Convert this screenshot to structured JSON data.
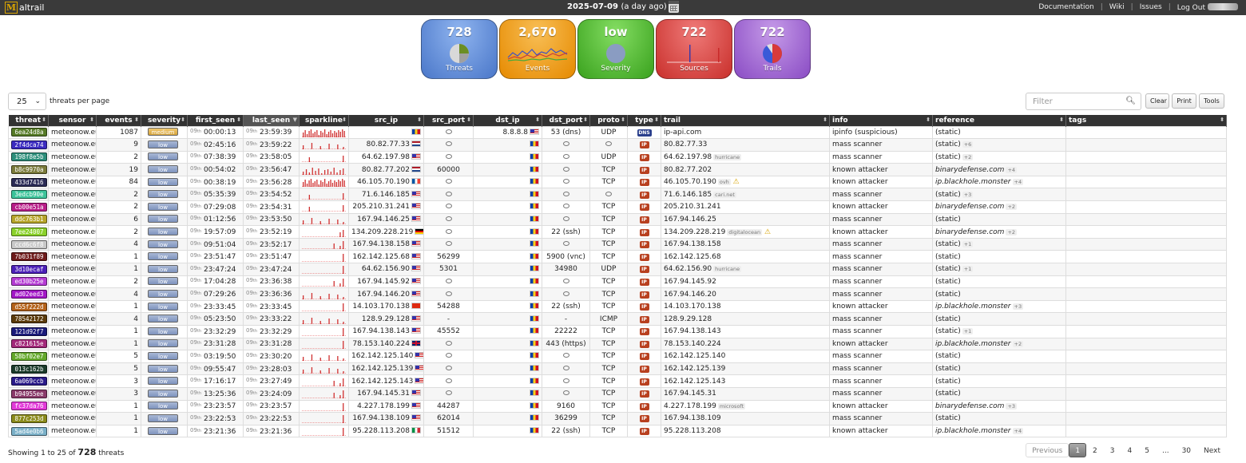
{
  "header": {
    "logo_text": "altrail",
    "date": "2025-07-09",
    "date_rel": "(a day ago)",
    "nav": [
      "Documentation",
      "Wiki",
      "Issues",
      "Log Out"
    ]
  },
  "tiles": [
    {
      "value": "728",
      "label": "Threats"
    },
    {
      "value": "2,670",
      "label": "Events"
    },
    {
      "value": "low",
      "label": "Severity"
    },
    {
      "value": "722",
      "label": "Sources"
    },
    {
      "value": "722",
      "label": "Trails"
    }
  ],
  "controls": {
    "per_page_value": "25",
    "per_page_label": "threats per page",
    "filter_placeholder": "Filter",
    "clear": "Clear",
    "print": "Print",
    "tools": "Tools"
  },
  "columns": [
    "threat",
    "sensor",
    "events",
    "severity",
    "first_seen",
    "last_seen",
    "sparkline",
    "src_ip",
    "src_port",
    "dst_ip",
    "dst_port",
    "proto",
    "type",
    "trail",
    "info",
    "reference",
    "tags"
  ],
  "colors": {
    "low": "#8a9cc2",
    "medium": "#e2b548",
    "ip_badge": "#b8401f",
    "dns_badge": "#2a3f8c"
  },
  "rows": [
    {
      "threat": "6ea24d8a",
      "color": "#557a26",
      "sensor": "meteonow.eu",
      "events": "1087",
      "severity": "medium",
      "first_sup": "th",
      "first_day": "09",
      "first_time": "00:00:13",
      "last_day": "09",
      "last_time": "23:59:39",
      "src_ip": "",
      "src_flag": "ro",
      "src_port": "",
      "dst_ip": "8.8.8.8",
      "dst_flag": "us",
      "dst_port": "53 (dns)",
      "proto": "UDP",
      "type": "DNS",
      "trail": "ip-api.com",
      "trail_tag": "",
      "warn": false,
      "info": "ipinfo (suspicious)",
      "reference": "(static)",
      "ref_extra": "",
      "ital": false,
      "spark": "dense"
    },
    {
      "threat": "2f4dca74",
      "color": "#3b2bc0",
      "sensor": "meteonow.eu",
      "events": "9",
      "severity": "low",
      "first_day": "09",
      "first_time": "02:45:16",
      "last_day": "09",
      "last_time": "23:59:22",
      "src_ip": "80.82.77.33",
      "src_flag": "nl",
      "src_port": "",
      "dst_ip": "",
      "dst_flag": "ro",
      "dst_port": "",
      "proto": "",
      "type": "IP",
      "trail": "80.82.77.33",
      "trail_tag": "",
      "warn": false,
      "info": "mass scanner",
      "reference": "(static)",
      "ref_extra": "+6",
      "ital": false,
      "spark": "few"
    },
    {
      "threat": "198f8e5b",
      "color": "#2c8e7a",
      "sensor": "meteonow.eu",
      "events": "2",
      "severity": "low",
      "first_day": "09",
      "first_time": "07:38:39",
      "last_day": "09",
      "last_time": "23:58:05",
      "src_ip": "64.62.197.98",
      "src_flag": "us",
      "src_port": "",
      "dst_ip": "",
      "dst_flag": "ro",
      "dst_port": "",
      "proto": "UDP",
      "type": "IP",
      "trail": "64.62.197.98",
      "trail_tag": "hurricane",
      "warn": false,
      "info": "mass scanner",
      "reference": "(static)",
      "ref_extra": "+2",
      "ital": false,
      "spark": "two"
    },
    {
      "threat": "b8c9970a",
      "color": "#7a7a3a",
      "sensor": "meteonow.eu",
      "events": "19",
      "severity": "low",
      "first_day": "09",
      "first_time": "00:54:02",
      "last_day": "09",
      "last_time": "23:56:47",
      "src_ip": "80.82.77.202",
      "src_flag": "nl",
      "src_port": "60000",
      "dst_ip": "",
      "dst_flag": "ro",
      "dst_port": "",
      "proto": "TCP",
      "type": "IP",
      "trail": "80.82.77.202",
      "trail_tag": "",
      "warn": false,
      "info": "known attacker",
      "reference": "binarydefense.com",
      "ref_extra": "+4",
      "ital": true,
      "spark": "many"
    },
    {
      "threat": "433d7416",
      "color": "#2a2a55",
      "sensor": "meteonow.eu",
      "events": "84",
      "severity": "low",
      "first_day": "09",
      "first_time": "00:38:19",
      "last_day": "09",
      "last_time": "23:56:28",
      "src_ip": "46.105.70.190",
      "src_flag": "fr",
      "src_port": "",
      "dst_ip": "",
      "dst_flag": "ro",
      "dst_port": "",
      "proto": "TCP",
      "type": "IP",
      "trail": "46.105.70.190",
      "trail_tag": "ovh",
      "warn": true,
      "info": "known attacker",
      "reference": "ip.blackhole.monster",
      "ref_extra": "+4",
      "ital": true,
      "spark": "dense"
    },
    {
      "threat": "3edcb90e",
      "color": "#3cc39a",
      "sensor": "meteonow.eu",
      "events": "2",
      "severity": "low",
      "first_day": "09",
      "first_time": "05:35:39",
      "last_day": "09",
      "last_time": "23:54:52",
      "src_ip": "71.6.146.185",
      "src_flag": "us",
      "src_port": "",
      "dst_ip": "",
      "dst_flag": "ro",
      "dst_port": "",
      "proto": "",
      "type": "IP",
      "trail": "71.6.146.185",
      "trail_tag": "cari.net",
      "warn": false,
      "info": "mass scanner",
      "reference": "(static)",
      "ref_extra": "+3",
      "ital": false,
      "spark": "two"
    },
    {
      "threat": "cb00e51a",
      "color": "#b81d88",
      "sensor": "meteonow.eu",
      "events": "2",
      "severity": "low",
      "first_day": "09",
      "first_time": "07:29:08",
      "last_day": "09",
      "last_time": "23:54:31",
      "src_ip": "205.210.31.241",
      "src_flag": "us",
      "src_port": "",
      "dst_ip": "",
      "dst_flag": "ro",
      "dst_port": "",
      "proto": "TCP",
      "type": "IP",
      "trail": "205.210.31.241",
      "trail_tag": "",
      "warn": false,
      "info": "known attacker",
      "reference": "binarydefense.com",
      "ref_extra": "+2",
      "ital": true,
      "spark": "two"
    },
    {
      "threat": "ddc763b1",
      "color": "#b7a52a",
      "sensor": "meteonow.eu",
      "events": "6",
      "severity": "low",
      "first_day": "09",
      "first_time": "01:12:56",
      "last_day": "09",
      "last_time": "23:53:50",
      "src_ip": "167.94.146.25",
      "src_flag": "us",
      "src_port": "",
      "dst_ip": "",
      "dst_flag": "ro",
      "dst_port": "",
      "proto": "TCP",
      "type": "IP",
      "trail": "167.94.146.25",
      "trail_tag": "",
      "warn": false,
      "info": "mass scanner",
      "reference": "(static)",
      "ref_extra": "",
      "ital": false,
      "spark": "few"
    },
    {
      "threat": "7ee24007",
      "color": "#8ad12a",
      "sensor": "meteonow.eu",
      "events": "2",
      "severity": "low",
      "first_day": "09",
      "first_time": "19:57:09",
      "last_day": "09",
      "last_time": "23:52:19",
      "src_ip": "134.209.228.219",
      "src_flag": "de",
      "src_port": "",
      "dst_ip": "",
      "dst_flag": "ro",
      "dst_port": "22 (ssh)",
      "proto": "TCP",
      "type": "IP",
      "trail": "134.209.228.219",
      "trail_tag": "digitalocean",
      "warn": true,
      "info": "known attacker",
      "reference": "binarydefense.com",
      "ref_extra": "+2",
      "ital": true,
      "spark": "endtwo"
    },
    {
      "threat": "ccd6c6f8",
      "color": "#c9c9c9",
      "sensor": "meteonow.eu",
      "events": "4",
      "severity": "low",
      "first_day": "09",
      "first_time": "09:51:04",
      "last_day": "09",
      "last_time": "23:52:17",
      "src_ip": "167.94.138.158",
      "src_flag": "us",
      "src_port": "",
      "dst_ip": "",
      "dst_flag": "ro",
      "dst_port": "",
      "proto": "TCP",
      "type": "IP",
      "trail": "167.94.138.158",
      "trail_tag": "",
      "warn": false,
      "info": "mass scanner",
      "reference": "(static)",
      "ref_extra": "+1",
      "ital": false,
      "spark": "end"
    },
    {
      "threat": "7b031f89",
      "color": "#6e1a1a",
      "sensor": "meteonow.eu",
      "events": "1",
      "severity": "low",
      "first_day": "09",
      "first_time": "23:51:47",
      "last_day": "09",
      "last_time": "23:51:47",
      "src_ip": "162.142.125.68",
      "src_flag": "us",
      "src_port": "56299",
      "dst_ip": "",
      "dst_flag": "ro",
      "dst_port": "5900 (vnc)",
      "proto": "TCP",
      "type": "IP",
      "trail": "162.142.125.68",
      "trail_tag": "",
      "warn": false,
      "info": "mass scanner",
      "reference": "(static)",
      "ref_extra": "",
      "ital": false,
      "spark": "one"
    },
    {
      "threat": "3d10ecaf",
      "color": "#4b1fb8",
      "sensor": "meteonow.eu",
      "events": "1",
      "severity": "low",
      "first_day": "09",
      "first_time": "23:47:24",
      "last_day": "09",
      "last_time": "23:47:24",
      "src_ip": "64.62.156.90",
      "src_flag": "us",
      "src_port": "5301",
      "dst_ip": "",
      "dst_flag": "ro",
      "dst_port": "34980",
      "proto": "UDP",
      "type": "IP",
      "trail": "64.62.156.90",
      "trail_tag": "hurricane",
      "warn": false,
      "info": "mass scanner",
      "reference": "(static)",
      "ref_extra": "+1",
      "ital": false,
      "spark": "one"
    },
    {
      "threat": "ed30b25e",
      "color": "#b43ad3",
      "sensor": "meteonow.eu",
      "events": "2",
      "severity": "low",
      "first_day": "09",
      "first_time": "17:04:28",
      "last_day": "09",
      "last_time": "23:36:38",
      "src_ip": "167.94.145.92",
      "src_flag": "us",
      "src_port": "",
      "dst_ip": "",
      "dst_flag": "ro",
      "dst_port": "",
      "proto": "TCP",
      "type": "IP",
      "trail": "167.94.145.92",
      "trail_tag": "",
      "warn": false,
      "info": "mass scanner",
      "reference": "(static)",
      "ref_extra": "",
      "ital": false,
      "spark": "end"
    },
    {
      "threat": "ad02eed3",
      "color": "#a316c7",
      "sensor": "meteonow.eu",
      "events": "4",
      "severity": "low",
      "first_day": "09",
      "first_time": "07:29:26",
      "last_day": "09",
      "last_time": "23:36:36",
      "src_ip": "167.94.146.20",
      "src_flag": "us",
      "src_port": "",
      "dst_ip": "",
      "dst_flag": "ro",
      "dst_port": "",
      "proto": "TCP",
      "type": "IP",
      "trail": "167.94.146.20",
      "trail_tag": "",
      "warn": false,
      "info": "mass scanner",
      "reference": "(static)",
      "ref_extra": "",
      "ital": false,
      "spark": "few"
    },
    {
      "threat": "d55f222d",
      "color": "#b4621a",
      "sensor": "meteonow.eu",
      "events": "1",
      "severity": "low",
      "first_day": "09",
      "first_time": "23:33:45",
      "last_day": "09",
      "last_time": "23:33:45",
      "src_ip": "14.103.170.138",
      "src_flag": "cn",
      "src_port": "54288",
      "dst_ip": "",
      "dst_flag": "ro",
      "dst_port": "22 (ssh)",
      "proto": "TCP",
      "type": "IP",
      "trail": "14.103.170.138",
      "trail_tag": "",
      "warn": false,
      "info": "known attacker",
      "reference": "ip.blackhole.monster",
      "ref_extra": "+3",
      "ital": true,
      "spark": "one"
    },
    {
      "threat": "78542172",
      "color": "#5a3a0a",
      "sensor": "meteonow.eu",
      "events": "4",
      "severity": "low",
      "first_day": "09",
      "first_time": "05:23:50",
      "last_day": "09",
      "last_time": "23:33:22",
      "src_ip": "128.9.29.128",
      "src_flag": "us",
      "src_port": "-",
      "dst_ip": "",
      "dst_flag": "ro",
      "dst_port": "-",
      "proto": "ICMP",
      "type": "IP",
      "trail": "128.9.29.128",
      "trail_tag": "",
      "warn": false,
      "info": "mass scanner",
      "reference": "(static)",
      "ref_extra": "",
      "ital": false,
      "spark": "few"
    },
    {
      "threat": "121d92f7",
      "color": "#1a1a7a",
      "sensor": "meteonow.eu",
      "events": "1",
      "severity": "low",
      "first_day": "09",
      "first_time": "23:32:29",
      "last_day": "09",
      "last_time": "23:32:29",
      "src_ip": "167.94.138.143",
      "src_flag": "us",
      "src_port": "45552",
      "dst_ip": "",
      "dst_flag": "ro",
      "dst_port": "22222",
      "proto": "TCP",
      "type": "IP",
      "trail": "167.94.138.143",
      "trail_tag": "",
      "warn": false,
      "info": "mass scanner",
      "reference": "(static)",
      "ref_extra": "+1",
      "ital": false,
      "spark": "one"
    },
    {
      "threat": "c821615e",
      "color": "#a3287a",
      "sensor": "meteonow.eu",
      "events": "1",
      "severity": "low",
      "first_day": "09",
      "first_time": "23:31:28",
      "last_day": "09",
      "last_time": "23:31:28",
      "src_ip": "78.153.140.224",
      "src_flag": "gb",
      "src_port": "",
      "dst_ip": "",
      "dst_flag": "ro",
      "dst_port": "443 (https)",
      "proto": "TCP",
      "type": "IP",
      "trail": "78.153.140.224",
      "trail_tag": "",
      "warn": false,
      "info": "known attacker",
      "reference": "ip.blackhole.monster",
      "ref_extra": "+2",
      "ital": true,
      "spark": "one"
    },
    {
      "threat": "58bf02e7",
      "color": "#63a82a",
      "sensor": "meteonow.eu",
      "events": "5",
      "severity": "low",
      "first_day": "09",
      "first_time": "03:19:50",
      "last_day": "09",
      "last_time": "23:30:20",
      "src_ip": "162.142.125.140",
      "src_flag": "us",
      "src_port": "",
      "dst_ip": "",
      "dst_flag": "ro",
      "dst_port": "",
      "proto": "TCP",
      "type": "IP",
      "trail": "162.142.125.140",
      "trail_tag": "",
      "warn": false,
      "info": "mass scanner",
      "reference": "(static)",
      "ref_extra": "",
      "ital": false,
      "spark": "few"
    },
    {
      "threat": "013c162b",
      "color": "#1a3a2a",
      "sensor": "meteonow.eu",
      "events": "5",
      "severity": "low",
      "first_day": "09",
      "first_time": "09:55:47",
      "last_day": "09",
      "last_time": "23:28:03",
      "src_ip": "162.142.125.139",
      "src_flag": "us",
      "src_port": "",
      "dst_ip": "",
      "dst_flag": "ro",
      "dst_port": "",
      "proto": "TCP",
      "type": "IP",
      "trail": "162.142.125.139",
      "trail_tag": "",
      "warn": false,
      "info": "mass scanner",
      "reference": "(static)",
      "ref_extra": "",
      "ital": false,
      "spark": "few"
    },
    {
      "threat": "6a069ccb",
      "color": "#2a1a8a",
      "sensor": "meteonow.eu",
      "events": "3",
      "severity": "low",
      "first_day": "09",
      "first_time": "17:16:17",
      "last_day": "09",
      "last_time": "23:27:49",
      "src_ip": "162.142.125.143",
      "src_flag": "us",
      "src_port": "",
      "dst_ip": "",
      "dst_flag": "ro",
      "dst_port": "",
      "proto": "TCP",
      "type": "IP",
      "trail": "162.142.125.143",
      "trail_tag": "",
      "warn": false,
      "info": "mass scanner",
      "reference": "(static)",
      "ref_extra": "",
      "ital": false,
      "spark": "end"
    },
    {
      "threat": "b94955ee",
      "color": "#8a3a6a",
      "sensor": "meteonow.eu",
      "events": "3",
      "severity": "low",
      "first_day": "09",
      "first_time": "13:25:36",
      "last_day": "09",
      "last_time": "23:24:09",
      "src_ip": "167.94.145.31",
      "src_flag": "us",
      "src_port": "",
      "dst_ip": "",
      "dst_flag": "ro",
      "dst_port": "",
      "proto": "TCP",
      "type": "IP",
      "trail": "167.94.145.31",
      "trail_tag": "",
      "warn": false,
      "info": "mass scanner",
      "reference": "(static)",
      "ref_extra": "",
      "ital": false,
      "spark": "end"
    },
    {
      "threat": "fc37da76",
      "color": "#e23ad8",
      "sensor": "meteonow.eu",
      "events": "1",
      "severity": "low",
      "first_day": "09",
      "first_time": "23:23:57",
      "last_day": "09",
      "last_time": "23:23:57",
      "src_ip": "4.227.178.199",
      "src_flag": "us",
      "src_port": "44287",
      "dst_ip": "",
      "dst_flag": "ro",
      "dst_port": "9160",
      "proto": "TCP",
      "type": "IP",
      "trail": "4.227.178.199",
      "trail_tag": "microsoft",
      "warn": false,
      "info": "known attacker",
      "reference": "binarydefense.com",
      "ref_extra": "+3",
      "ital": true,
      "spark": "one"
    },
    {
      "threat": "877c253d",
      "color": "#8a8a1a",
      "sensor": "meteonow.eu",
      "events": "1",
      "severity": "low",
      "first_day": "09",
      "first_time": "23:22:53",
      "last_day": "09",
      "last_time": "23:22:53",
      "src_ip": "167.94.138.109",
      "src_flag": "us",
      "src_port": "62014",
      "dst_ip": "",
      "dst_flag": "ro",
      "dst_port": "36299",
      "proto": "TCP",
      "type": "IP",
      "trail": "167.94.138.109",
      "trail_tag": "",
      "warn": false,
      "info": "mass scanner",
      "reference": "(static)",
      "ref_extra": "",
      "ital": false,
      "spark": "one"
    },
    {
      "threat": "5ad4e0b6",
      "color": "#7ab0c8",
      "sensor": "meteonow.eu",
      "events": "1",
      "severity": "low",
      "first_day": "09",
      "first_time": "23:21:36",
      "last_day": "09",
      "last_time": "23:21:36",
      "src_ip": "95.228.113.208",
      "src_flag": "it",
      "src_port": "51512",
      "dst_ip": "",
      "dst_flag": "ro",
      "dst_port": "22 (ssh)",
      "proto": "TCP",
      "type": "IP",
      "trail": "95.228.113.208",
      "trail_tag": "",
      "warn": false,
      "info": "known attacker",
      "reference": "ip.blackhole.monster",
      "ref_extra": "+4",
      "ital": true,
      "spark": "one"
    }
  ],
  "footer": {
    "showing_prefix": "Showing 1 to 25 of",
    "total": "728",
    "showing_suffix": "threats",
    "pages": [
      "Previous",
      "1",
      "2",
      "3",
      "4",
      "5",
      "...",
      "30",
      "Next"
    ]
  }
}
